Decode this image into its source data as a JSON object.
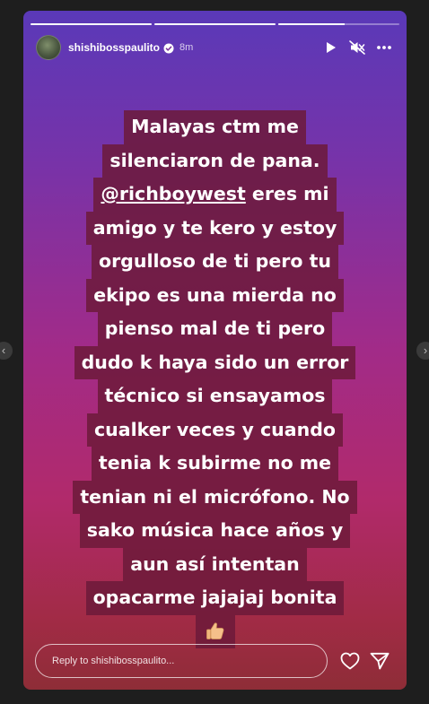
{
  "story": {
    "progress": [
      1,
      1,
      0.55
    ],
    "user": {
      "username": "shishibosspaulito",
      "verified": true,
      "time_ago": "8m"
    },
    "header_icons": [
      "play-icon",
      "muted-speaker-icon",
      "more-icon"
    ],
    "text_lines": [
      "Malayas ctm me",
      "silenciaron de pana.",
      "eres mi",
      "amigo y te kero y estoy",
      "orgulloso de ti pero tu",
      "ekipo es una mierda no",
      "pienso mal de ti pero",
      "dudo k haya sido un error",
      "técnico si ensayamos",
      "cualker veces y cuando",
      "tenia k subirme no me",
      "tenian ni el micrófono. No",
      "sako música hace años y",
      "aun así intentan",
      "opacarme jajajaj bonita"
    ],
    "mention": "@richboywest",
    "emoji": "thumbs-up-emoji",
    "reply": {
      "placeholder": "Reply to shishibosspaulito..."
    },
    "footer_icons": [
      "heart-icon",
      "send-icon"
    ],
    "colors": {
      "text_bg": "#6c1a3a",
      "gradient_top": "#5a39b8",
      "gradient_bottom": "#8e2d37"
    }
  }
}
